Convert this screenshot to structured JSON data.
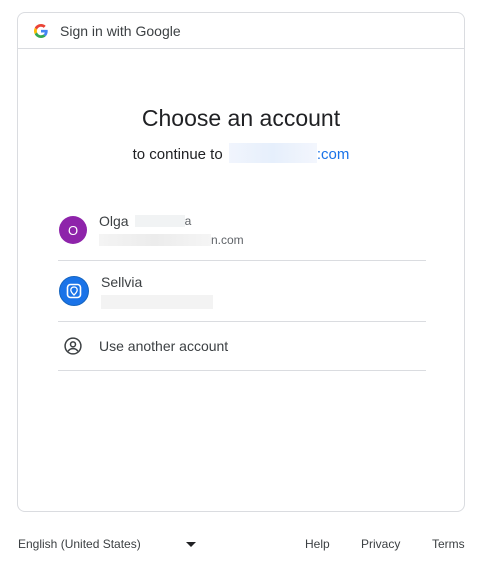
{
  "header": {
    "title": "Sign in with Google"
  },
  "main": {
    "title": "Choose an account",
    "subtitle_prefix": "to continue to",
    "subtitle_domain": ":com"
  },
  "accounts": [
    {
      "avatar_letter": "O",
      "name": "Olga",
      "name_tail": "a",
      "email_tail": "n.com"
    },
    {
      "name": "Sellvia"
    }
  ],
  "another_account": {
    "label": "Use another account"
  },
  "footer": {
    "language": "English (United States)",
    "help": "Help",
    "privacy": "Privacy",
    "terms": "Terms"
  },
  "colors": {
    "accent": "#1a73e8",
    "avatar_purple": "#8e24aa",
    "border": "#dadce0"
  },
  "icons": {
    "header": "google-g-icon",
    "another_account": "account-circle-icon",
    "language_dropdown": "caret-down-icon",
    "sellvia_avatar": "sellvia-logo-icon"
  }
}
